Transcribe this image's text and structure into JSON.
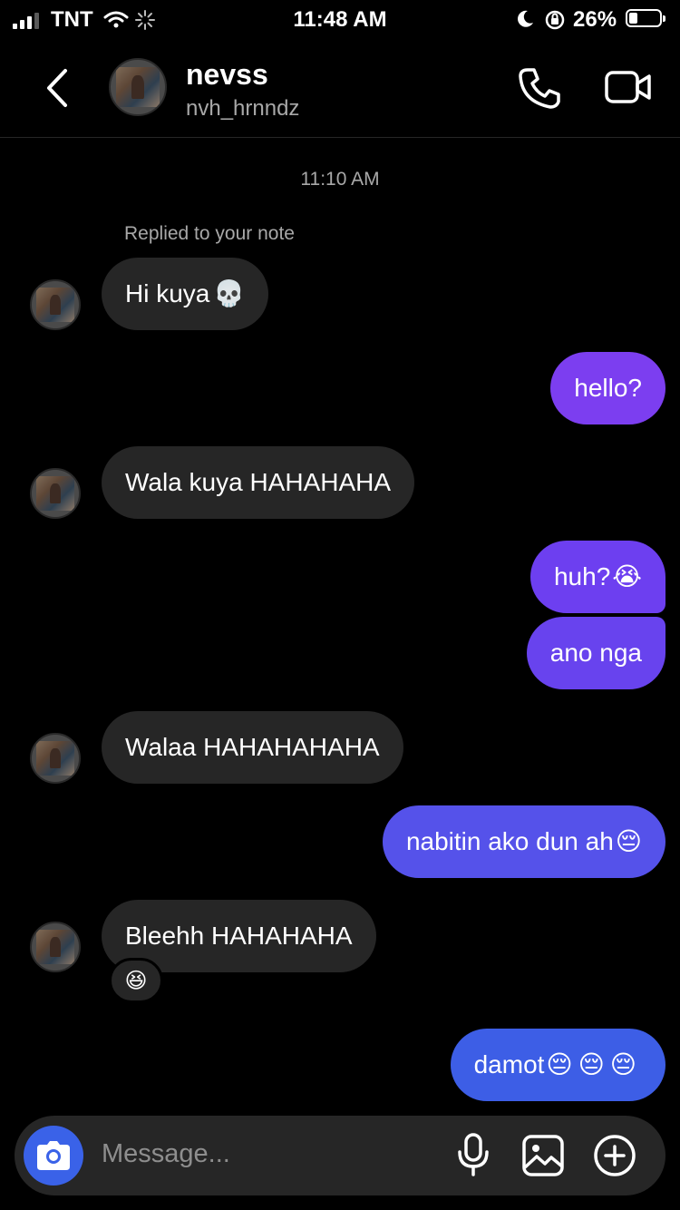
{
  "status_bar": {
    "carrier": "TNT",
    "time": "11:48 AM",
    "battery": "26%"
  },
  "header": {
    "name": "nevss",
    "username": "nvh_hrnndz"
  },
  "thread": {
    "timestamp": "11:10 AM",
    "reply_note": "Replied to your note",
    "messages": [
      {
        "from": "them",
        "text": "Hi kuya",
        "emoji": "💀"
      },
      {
        "from": "me",
        "text": "hello?"
      },
      {
        "from": "them",
        "text": "Wala kuya HAHAHAHA"
      },
      {
        "from": "me",
        "text": "huh?",
        "emoji": "😭"
      },
      {
        "from": "me",
        "text": "ano nga"
      },
      {
        "from": "them",
        "text": "Walaa HAHAHAHAHA"
      },
      {
        "from": "me",
        "text": "nabitin ako dun ah",
        "emoji": "😔"
      },
      {
        "from": "them",
        "text": "Bleehh  HAHAHAHA",
        "reaction": "😆"
      },
      {
        "from": "me",
        "text": "damot",
        "emoji": "😔😔😔"
      }
    ]
  },
  "composer": {
    "placeholder": "Message..."
  },
  "colors": {
    "incoming_bubble": "#262626",
    "camera_button": "#3a62e8",
    "outgoing_top": "#7c3ef0",
    "outgoing_bottom": "#3d5ee6"
  }
}
